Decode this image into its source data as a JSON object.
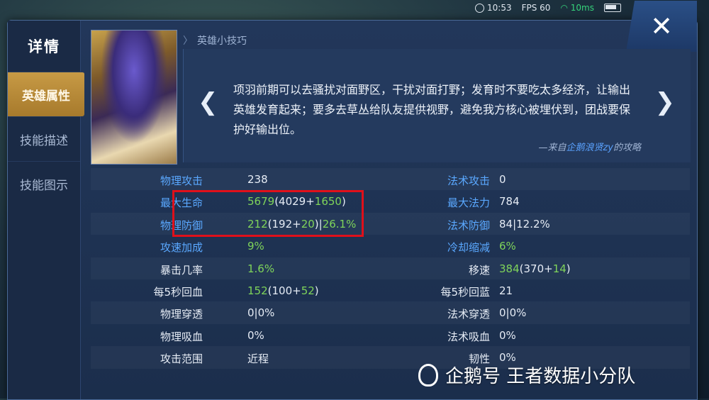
{
  "status": {
    "time": "10:53",
    "fps": "FPS 60",
    "ping": "10ms"
  },
  "sidebar": {
    "title": "详情",
    "tabs": [
      {
        "label": "英雄属性",
        "active": true
      },
      {
        "label": "技能描述",
        "active": false
      },
      {
        "label": "技能图示",
        "active": false
      }
    ]
  },
  "close_label": "✕",
  "tips": {
    "header": "英雄小技巧",
    "text": "项羽前期可以去骚扰对面野区，干扰对面打野；发育时不要吃太多经济，让输出英雄发育起来；要多去草丛给队友提供视野，避免我方核心被埋伏到，团战要保护好输出位。",
    "source_prefix": "—来自",
    "source_author": "企鹅浪贤zy",
    "source_suffix": "的攻略"
  },
  "stats_left": [
    {
      "label": "物理攻击",
      "label_color": "blue",
      "parts": [
        [
          "238",
          "white"
        ]
      ]
    },
    {
      "label": "最大生命",
      "label_color": "blue",
      "parts": [
        [
          "5679",
          "green"
        ],
        [
          "(4029+",
          "white"
        ],
        [
          "1650",
          "green"
        ],
        [
          ")",
          "white"
        ]
      ]
    },
    {
      "label": "物理防御",
      "label_color": "blue",
      "parts": [
        [
          "212",
          "green"
        ],
        [
          "(192+",
          "white"
        ],
        [
          "20",
          "green"
        ],
        [
          ")|",
          "white"
        ],
        [
          "26.1%",
          "green"
        ]
      ]
    },
    {
      "label": "攻速加成",
      "label_color": "blue",
      "parts": [
        [
          "9%",
          "green"
        ]
      ]
    },
    {
      "label": "暴击几率",
      "label_color": "white",
      "parts": [
        [
          "1.6%",
          "green"
        ]
      ]
    },
    {
      "label": "每5秒回血",
      "label_color": "white",
      "parts": [
        [
          "152",
          "green"
        ],
        [
          "(100+",
          "white"
        ],
        [
          "52",
          "green"
        ],
        [
          ")",
          "white"
        ]
      ]
    },
    {
      "label": "物理穿透",
      "label_color": "white",
      "parts": [
        [
          "0|0%",
          "white"
        ]
      ]
    },
    {
      "label": "物理吸血",
      "label_color": "white",
      "parts": [
        [
          "0%",
          "white"
        ]
      ]
    },
    {
      "label": "攻击范围",
      "label_color": "white",
      "parts": [
        [
          "近程",
          "white"
        ]
      ]
    }
  ],
  "stats_right": [
    {
      "label": "法术攻击",
      "label_color": "blue",
      "parts": [
        [
          "0",
          "white"
        ]
      ]
    },
    {
      "label": "最大法力",
      "label_color": "blue",
      "parts": [
        [
          "784",
          "white"
        ]
      ]
    },
    {
      "label": "法术防御",
      "label_color": "blue",
      "parts": [
        [
          "84|12.2%",
          "white"
        ]
      ]
    },
    {
      "label": "冷却缩减",
      "label_color": "blue",
      "parts": [
        [
          "6%",
          "green"
        ]
      ]
    },
    {
      "label": "移速",
      "label_color": "white",
      "parts": [
        [
          "384",
          "green"
        ],
        [
          "(370+",
          "white"
        ],
        [
          "14",
          "green"
        ],
        [
          ")",
          "white"
        ]
      ]
    },
    {
      "label": "每5秒回蓝",
      "label_color": "white",
      "parts": [
        [
          "21",
          "white"
        ]
      ]
    },
    {
      "label": "法术穿透",
      "label_color": "white",
      "parts": [
        [
          "0|0%",
          "white"
        ]
      ]
    },
    {
      "label": "法术吸血",
      "label_color": "white",
      "parts": [
        [
          "0%",
          "white"
        ]
      ]
    },
    {
      "label": "韧性",
      "label_color": "white",
      "parts": [
        [
          "0%",
          "white"
        ]
      ]
    }
  ],
  "watermark": "企鹅号 王者数据小分队",
  "colors": {
    "blue_label": "#5aa8ff",
    "green_value": "#7fd45a",
    "active_tab": "#c79a45",
    "highlight": "#e0101a"
  }
}
